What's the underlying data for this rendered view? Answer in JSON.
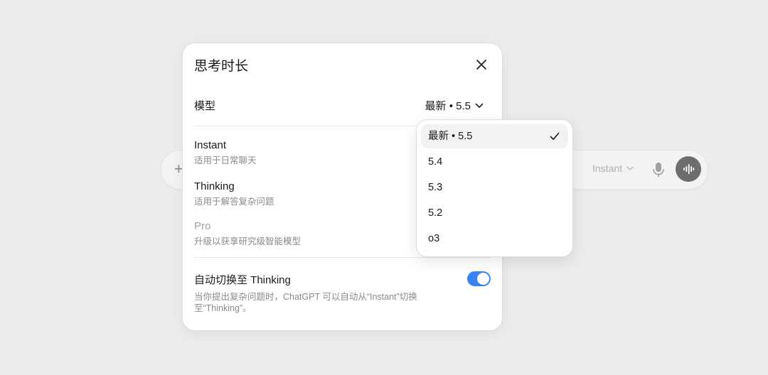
{
  "composer": {
    "plus_glyph": "+",
    "model_label": "Instant",
    "icons": [
      "plus-icon",
      "chevron-down-icon",
      "microphone-icon",
      "voice-waveform-icon"
    ]
  },
  "dialog": {
    "title": "思考时长",
    "close_icon": "close-icon",
    "model_row_label": "模型",
    "model_selected_label": "最新 • 5.5",
    "options": [
      {
        "name": "Instant",
        "desc": "适用于日常聊天",
        "disabled": false
      },
      {
        "name": "Thinking",
        "desc": "适用于解答复杂问题",
        "disabled": false
      },
      {
        "name": "Pro",
        "desc": "升级以获享研究级智能模型",
        "disabled": true
      }
    ],
    "auto_switch": {
      "label": "自动切换至 Thinking",
      "desc": "当你提出复杂问题时，ChatGPT 可以自动从“Instant”切换至“Thinking”。",
      "enabled": true
    }
  },
  "dropdown": {
    "items": [
      {
        "label": "最新 • 5.5",
        "selected": true
      },
      {
        "label": "5.4",
        "selected": false
      },
      {
        "label": "5.3",
        "selected": false
      },
      {
        "label": "5.2",
        "selected": false
      },
      {
        "label": "o3",
        "selected": false
      }
    ]
  },
  "colors": {
    "accent": "#3b82f6",
    "background": "#ececec",
    "panel": "#ffffff"
  }
}
